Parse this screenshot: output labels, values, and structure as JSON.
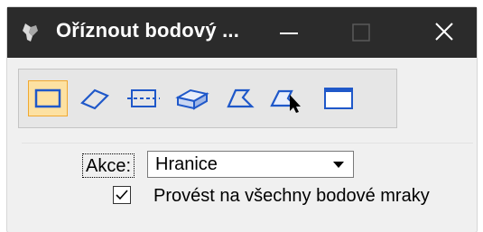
{
  "window": {
    "title": "Oříznout bodový ...",
    "icon": "app-icon"
  },
  "titlebar_buttons": {
    "minimize": "minimize-icon",
    "maximize": "maximize-icon",
    "close": "close-icon"
  },
  "toolbar": {
    "tools": [
      {
        "name": "clip-by-block",
        "active": true
      },
      {
        "name": "clip-by-rotated-block",
        "active": false
      },
      {
        "name": "clip-by-section",
        "active": false
      },
      {
        "name": "clip-by-volume",
        "active": false
      },
      {
        "name": "clip-by-shape",
        "active": false
      },
      {
        "name": "clip-by-element",
        "active": false
      },
      {
        "name": "clip-by-view",
        "active": false
      }
    ]
  },
  "form": {
    "action_label": "Akce:",
    "action_value": "Hranice",
    "apply_all_label": "Provést na všechny bodové mraky",
    "apply_all_checked": true
  },
  "colors": {
    "titlebar": "#2b2b2b",
    "icon_blue": "#1f58c9",
    "active_tool_bg": "#fde1a2",
    "active_tool_border": "#f0a830"
  }
}
